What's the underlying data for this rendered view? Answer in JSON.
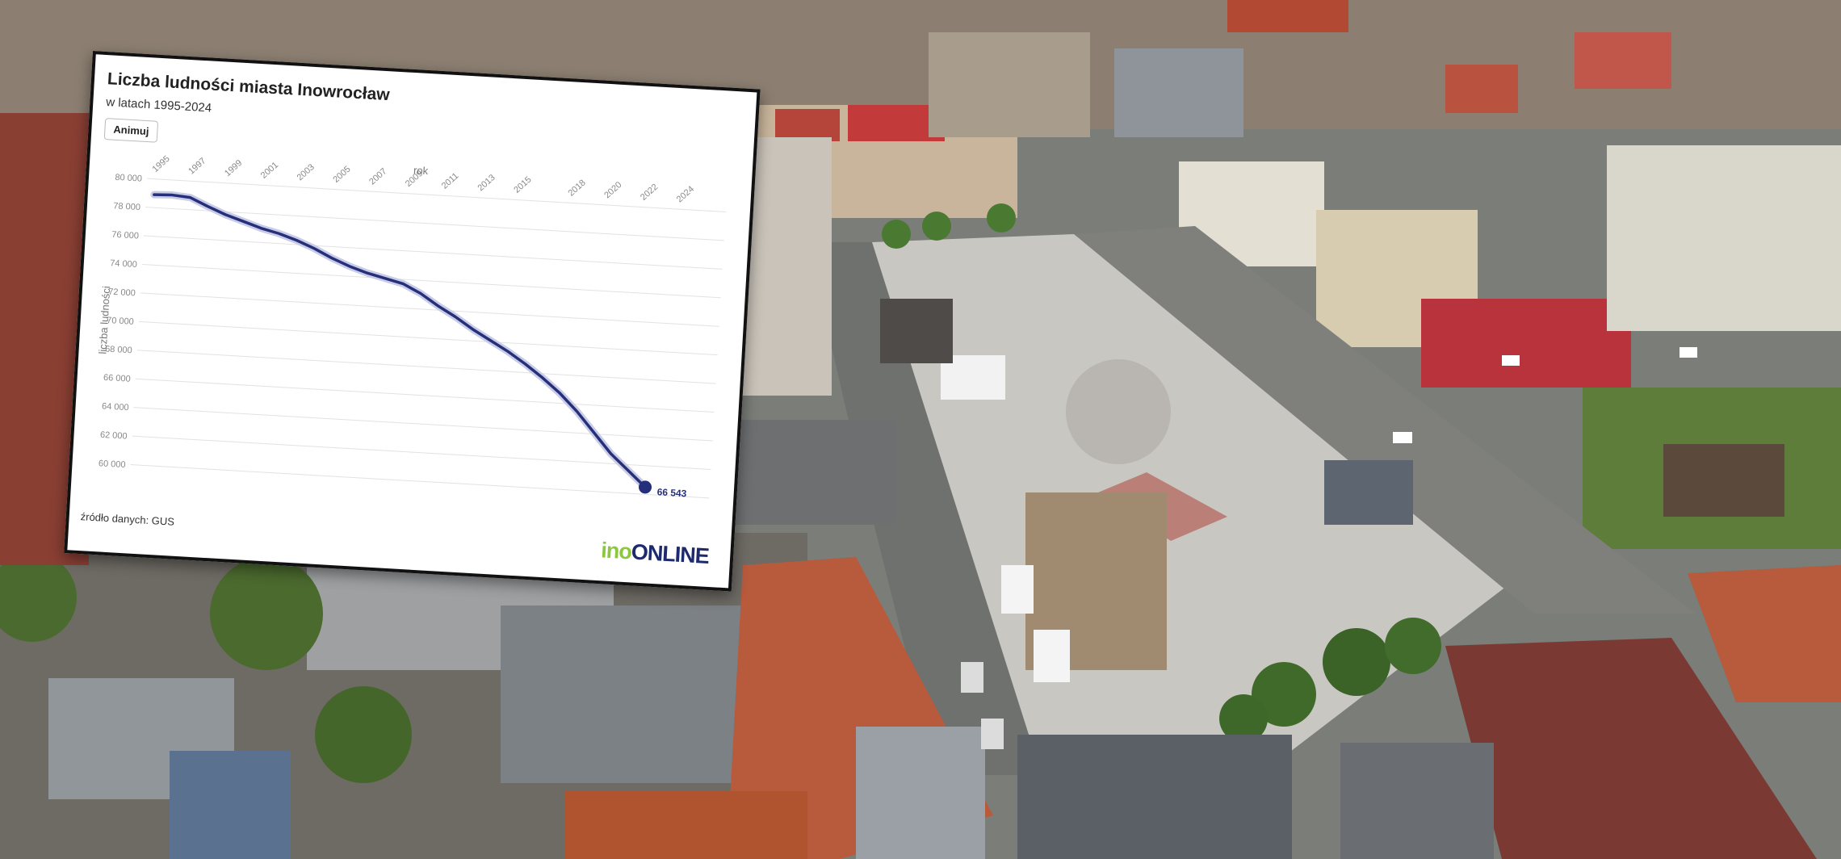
{
  "chart_data": {
    "type": "line",
    "title": "Liczba ludności miasta Inowrocław",
    "subtitle": "w latach 1995-2024",
    "xlabel": "rok",
    "ylabel": "liczba ludności",
    "x_tick_labels": [
      "1995",
      "1997",
      "1999",
      "2001",
      "2003",
      "2005",
      "2007",
      "2009",
      "2011",
      "2013",
      "2015",
      "2018",
      "2020",
      "2022",
      "2024"
    ],
    "y_tick_labels": [
      "80 000",
      "78 000",
      "76 000",
      "74 000",
      "72 000",
      "70 000",
      "68 000",
      "66 000",
      "64 000",
      "62 000",
      "60 000"
    ],
    "ylim": [
      60000,
      80000
    ],
    "grid": true,
    "x": [
      "1995",
      "1996",
      "1997",
      "1998",
      "1999",
      "2000",
      "2001",
      "2002",
      "2003",
      "2004",
      "2005",
      "2006",
      "2007",
      "2008",
      "2009",
      "2010",
      "2011",
      "2012",
      "2013",
      "2014",
      "2015",
      "2016",
      "2017",
      "2018",
      "2019",
      "2020",
      "2021",
      "2022",
      "2023"
    ],
    "values": [
      78900,
      78950,
      78850,
      78300,
      77800,
      77400,
      77000,
      76700,
      76300,
      75800,
      75200,
      74700,
      74300,
      74000,
      73700,
      73100,
      72300,
      71600,
      70800,
      70100,
      69400,
      68600,
      67700,
      66700,
      65500,
      64100,
      62700,
      61600,
      60500
    ],
    "annotation": "66 543",
    "line_color": "#26307a"
  },
  "controls": {
    "animate_label": "Animuj"
  },
  "footer": {
    "source": "źródło danych: GUS"
  },
  "brand": {
    "part1": "ino",
    "part2": "ONLINE"
  }
}
